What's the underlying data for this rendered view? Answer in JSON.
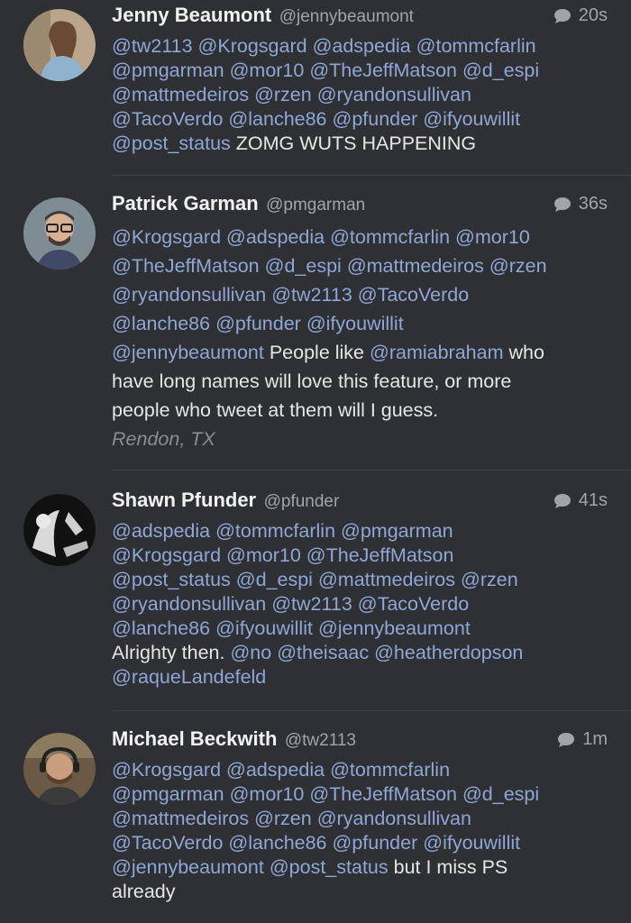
{
  "tweets": [
    {
      "name": "Jenny Beaumont",
      "handle": "@jennybeaumont",
      "time": "20s",
      "lines": [
        [
          {
            "t": "@tw2113",
            "m": true
          },
          {
            "t": " "
          },
          {
            "t": "@Krogsgard",
            "m": true
          },
          {
            "t": " "
          },
          {
            "t": "@adspedia",
            "m": true
          },
          {
            "t": " "
          },
          {
            "t": "@tommcfarlin",
            "m": true
          }
        ],
        [
          {
            "t": "@pmgarman",
            "m": true
          },
          {
            "t": " "
          },
          {
            "t": "@mor10",
            "m": true
          },
          {
            "t": " "
          },
          {
            "t": "@TheJeffMatson",
            "m": true
          },
          {
            "t": " "
          },
          {
            "t": "@d_espi",
            "m": true
          }
        ],
        [
          {
            "t": "@mattmedeiros",
            "m": true
          },
          {
            "t": " "
          },
          {
            "t": "@rzen",
            "m": true
          },
          {
            "t": " "
          },
          {
            "t": "@ryandonsullivan",
            "m": true
          }
        ],
        [
          {
            "t": "@TacoVerdo",
            "m": true
          },
          {
            "t": " "
          },
          {
            "t": "@lanche86",
            "m": true
          },
          {
            "t": " "
          },
          {
            "t": "@pfunder",
            "m": true
          },
          {
            "t": " "
          },
          {
            "t": "@ifyouwillit",
            "m": true
          }
        ],
        [
          {
            "t": "@post_status",
            "m": true
          },
          {
            "t": " ZOMG WUTS HAPPENING"
          }
        ]
      ],
      "location": ""
    },
    {
      "name": "Patrick Garman",
      "handle": "@pmgarman",
      "time": "36s",
      "lines": [
        [
          {
            "t": "@Krogsgard",
            "m": true
          },
          {
            "t": " "
          },
          {
            "t": "@adspedia",
            "m": true
          },
          {
            "t": " "
          },
          {
            "t": "@tommcfarlin",
            "m": true
          },
          {
            "t": " "
          },
          {
            "t": "@mor10",
            "m": true
          }
        ],
        [
          {
            "t": "@TheJeffMatson",
            "m": true
          },
          {
            "t": " "
          },
          {
            "t": "@d_espi",
            "m": true
          },
          {
            "t": " "
          },
          {
            "t": "@mattmedeiros",
            "m": true
          },
          {
            "t": " "
          },
          {
            "t": "@rzen",
            "m": true
          }
        ],
        [
          {
            "t": "@ryandonsullivan",
            "m": true
          },
          {
            "t": " "
          },
          {
            "t": "@tw2113",
            "m": true
          },
          {
            "t": " "
          },
          {
            "t": "@TacoVerdo",
            "m": true
          }
        ],
        [
          {
            "t": "@lanche86",
            "m": true
          },
          {
            "t": " "
          },
          {
            "t": "@pfunder",
            "m": true
          },
          {
            "t": " "
          },
          {
            "t": "@ifyouwillit",
            "m": true
          }
        ],
        [
          {
            "t": "@jennybeaumont",
            "m": true
          },
          {
            "t": " People like "
          },
          {
            "t": "@ramiabraham",
            "m": true
          },
          {
            "t": " who"
          }
        ],
        [
          {
            "t": "have long names will love this feature, or more"
          }
        ],
        [
          {
            "t": "people who tweet at them will I guess."
          }
        ]
      ],
      "location": "Rendon, TX"
    },
    {
      "name": "Shawn Pfunder",
      "handle": "@pfunder",
      "time": "41s",
      "lines": [
        [
          {
            "t": "@adspedia",
            "m": true
          },
          {
            "t": " "
          },
          {
            "t": "@tommcfarlin",
            "m": true
          },
          {
            "t": " "
          },
          {
            "t": "@pmgarman",
            "m": true
          }
        ],
        [
          {
            "t": "@Krogsgard",
            "m": true
          },
          {
            "t": " "
          },
          {
            "t": "@mor10",
            "m": true
          },
          {
            "t": " "
          },
          {
            "t": "@TheJeffMatson",
            "m": true
          }
        ],
        [
          {
            "t": "@post_status",
            "m": true
          },
          {
            "t": " "
          },
          {
            "t": "@d_espi",
            "m": true
          },
          {
            "t": " "
          },
          {
            "t": "@mattmedeiros",
            "m": true
          },
          {
            "t": " "
          },
          {
            "t": "@rzen",
            "m": true
          }
        ],
        [
          {
            "t": "@ryandonsullivan",
            "m": true
          },
          {
            "t": " "
          },
          {
            "t": "@tw2113",
            "m": true
          },
          {
            "t": " "
          },
          {
            "t": "@TacoVerdo",
            "m": true
          }
        ],
        [
          {
            "t": "@lanche86",
            "m": true
          },
          {
            "t": " "
          },
          {
            "t": "@ifyouwillit",
            "m": true
          },
          {
            "t": " "
          },
          {
            "t": "@jennybeaumont",
            "m": true
          }
        ],
        [
          {
            "t": "Alrighty then. "
          },
          {
            "t": "@no",
            "m": true
          },
          {
            "t": " "
          },
          {
            "t": "@theisaac",
            "m": true
          },
          {
            "t": " "
          },
          {
            "t": "@heatherdopson",
            "m": true
          }
        ],
        [
          {
            "t": "@raqueLandefeld",
            "m": true
          }
        ]
      ],
      "location": ""
    },
    {
      "name": "Michael Beckwith",
      "handle": "@tw2113",
      "time": "1m",
      "lines": [
        [
          {
            "t": "@Krogsgard",
            "m": true
          },
          {
            "t": " "
          },
          {
            "t": "@adspedia",
            "m": true
          },
          {
            "t": " "
          },
          {
            "t": "@tommcfarlin",
            "m": true
          }
        ],
        [
          {
            "t": "@pmgarman",
            "m": true
          },
          {
            "t": " "
          },
          {
            "t": "@mor10",
            "m": true
          },
          {
            "t": " "
          },
          {
            "t": "@TheJeffMatson",
            "m": true
          },
          {
            "t": " "
          },
          {
            "t": "@d_espi",
            "m": true
          }
        ],
        [
          {
            "t": "@mattmedeiros",
            "m": true
          },
          {
            "t": " "
          },
          {
            "t": "@rzen",
            "m": true
          },
          {
            "t": " "
          },
          {
            "t": "@ryandonsullivan",
            "m": true
          }
        ],
        [
          {
            "t": "@TacoVerdo",
            "m": true
          },
          {
            "t": " "
          },
          {
            "t": "@lanche86",
            "m": true
          },
          {
            "t": " "
          },
          {
            "t": "@pfunder",
            "m": true
          },
          {
            "t": " "
          },
          {
            "t": "@ifyouwillit",
            "m": true
          }
        ],
        [
          {
            "t": "@jennybeaumont",
            "m": true
          },
          {
            "t": " "
          },
          {
            "t": "@post_status",
            "m": true
          },
          {
            "t": " but I miss PS"
          }
        ],
        [
          {
            "t": "already"
          }
        ]
      ],
      "location": ""
    }
  ],
  "icons": {
    "reply": "speech-bubble-icon"
  },
  "colors": {
    "background": "#2f3033",
    "mention": "#8ea7d6",
    "meta": "#a3a4a8"
  }
}
